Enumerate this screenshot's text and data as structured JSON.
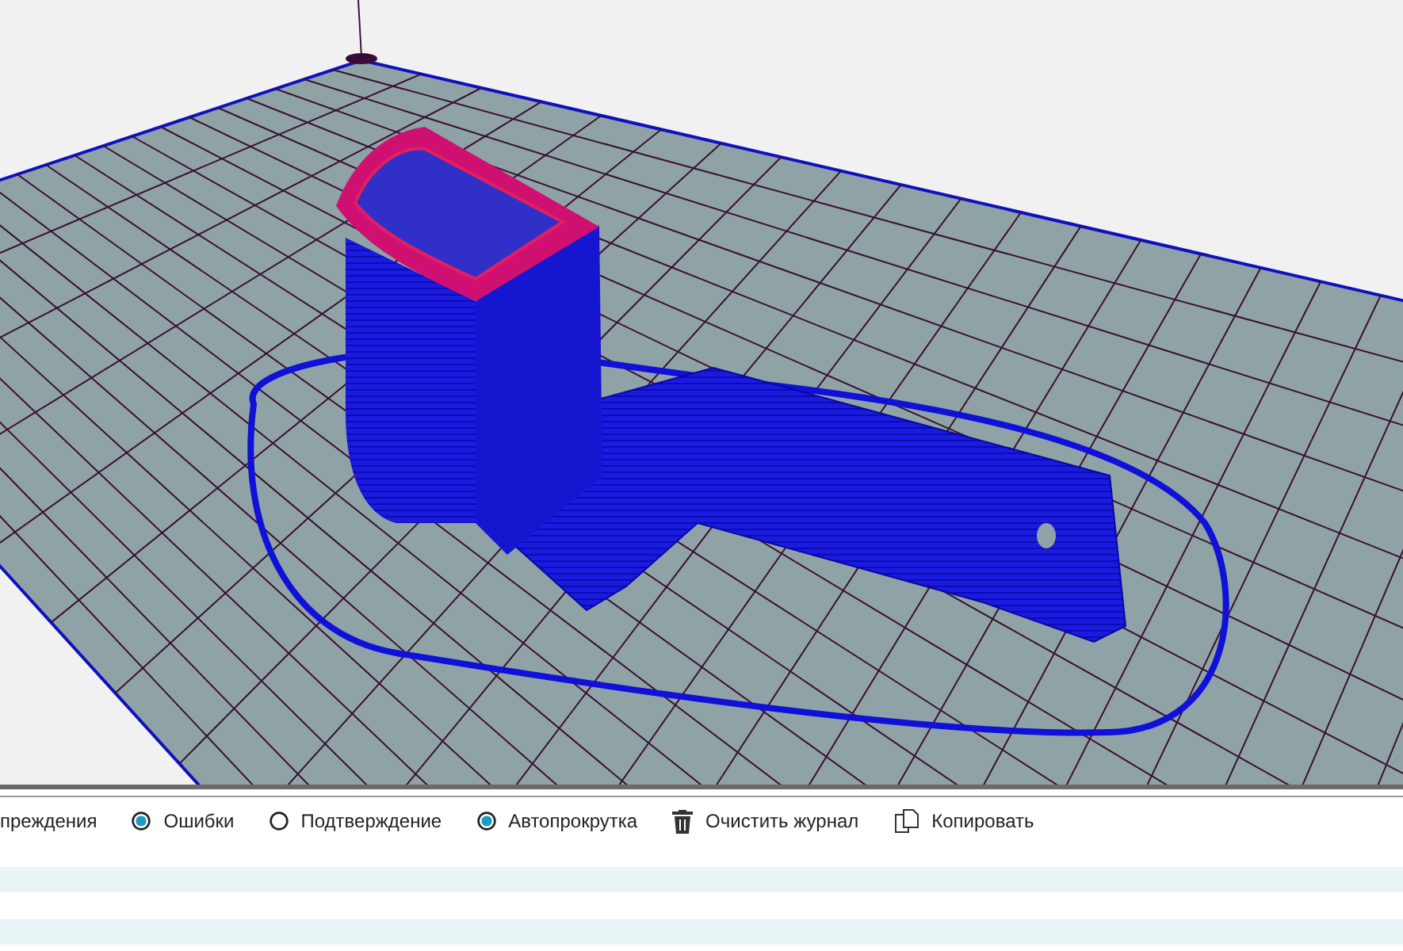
{
  "log_toolbar": {
    "items": [
      {
        "kind": "label",
        "label": "преждения"
      },
      {
        "kind": "toggle",
        "label": "Ошибки",
        "checked": true
      },
      {
        "kind": "toggle",
        "label": "Подтверждение",
        "checked": false
      },
      {
        "kind": "toggle",
        "label": "Автопрокрутка",
        "checked": true
      },
      {
        "kind": "trash",
        "label": "Очистить журнал"
      },
      {
        "kind": "copy",
        "label": "Копировать"
      }
    ]
  }
}
